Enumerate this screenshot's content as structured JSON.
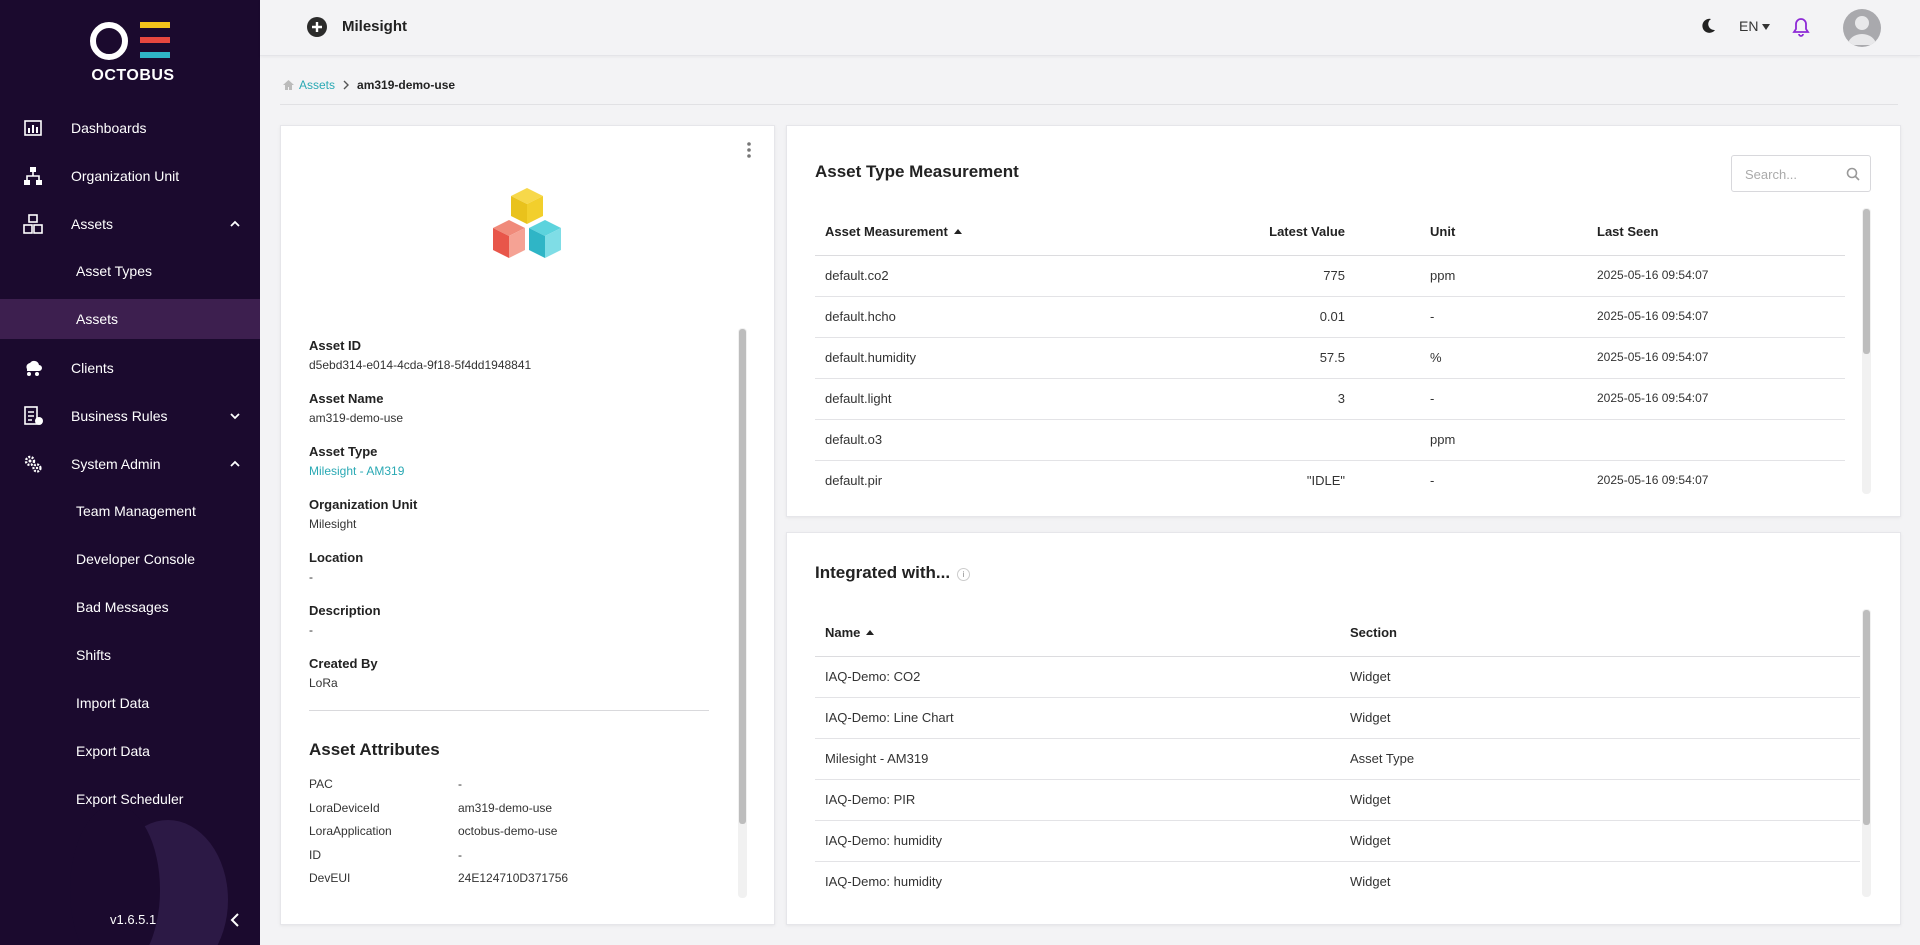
{
  "brand": {
    "name": "OCTOBUS",
    "colors": {
      "sidebar": "#1b0a2e",
      "accent": "#2aa9b4",
      "bell": "#8e2bd6"
    }
  },
  "sidebar": {
    "items": [
      {
        "label": "Dashboards",
        "icon": "dashboard-icon"
      },
      {
        "label": "Organization Unit",
        "icon": "org-chart-icon"
      },
      {
        "label": "Assets",
        "icon": "cubes-icon",
        "expanded": true
      },
      {
        "label": "Clients",
        "icon": "cloud-users-icon"
      },
      {
        "label": "Business Rules",
        "icon": "rules-icon",
        "expanded": false
      },
      {
        "label": "System Admin",
        "icon": "gears-icon",
        "expanded": true
      }
    ],
    "asset_subitems": [
      "Asset Types",
      "Assets"
    ],
    "admin_subitems": [
      "Team Management",
      "Developer Console",
      "Bad Messages",
      "Shifts",
      "Import Data",
      "Export Data",
      "Export Scheduler"
    ],
    "active": "Assets",
    "version": "v1.6.5.1"
  },
  "topbar": {
    "org_name": "Milesight",
    "language": "EN"
  },
  "breadcrumb": {
    "parent": "Assets",
    "current": "am319-demo-use"
  },
  "asset": {
    "fields": [
      {
        "label": "Asset ID",
        "value": "d5ebd314-e014-4cda-9f18-5f4dd1948841"
      },
      {
        "label": "Asset Name",
        "value": "am319-demo-use"
      },
      {
        "label": "Asset Type",
        "value": "Milesight - AM319",
        "link": true
      },
      {
        "label": "Organization Unit",
        "value": "Milesight"
      },
      {
        "label": "Location",
        "value": "-"
      },
      {
        "label": "Description",
        "value": "-"
      },
      {
        "label": "Created By",
        "value": "LoRa"
      }
    ],
    "attributes_title": "Asset Attributes",
    "attributes": [
      {
        "key": "PAC",
        "value": "-"
      },
      {
        "key": "LoraDeviceId",
        "value": "am319-demo-use"
      },
      {
        "key": "LoraApplication",
        "value": "octobus-demo-use"
      },
      {
        "key": "ID",
        "value": "-"
      },
      {
        "key": "DevEUI",
        "value": "24E124710D371756"
      }
    ]
  },
  "measurements": {
    "title": "Asset Type Measurement",
    "search_placeholder": "Search...",
    "columns": [
      "Asset Measurement",
      "Latest Value",
      "Unit",
      "Last Seen"
    ],
    "rows": [
      {
        "name": "default.co2",
        "value": "775",
        "unit": "ppm",
        "last_seen": "2025-05-16 09:54:07"
      },
      {
        "name": "default.hcho",
        "value": "0.01",
        "unit": "-",
        "last_seen": "2025-05-16 09:54:07"
      },
      {
        "name": "default.humidity",
        "value": "57.5",
        "unit": "%",
        "last_seen": "2025-05-16 09:54:07"
      },
      {
        "name": "default.light",
        "value": "3",
        "unit": "-",
        "last_seen": "2025-05-16 09:54:07"
      },
      {
        "name": "default.o3",
        "value": "",
        "unit": "ppm",
        "last_seen": ""
      },
      {
        "name": "default.pir",
        "value": "\"IDLE\"",
        "unit": "-",
        "last_seen": "2025-05-16 09:54:07"
      }
    ]
  },
  "integrations": {
    "title": "Integrated with...",
    "info_glyph": "i",
    "columns": [
      "Name",
      "Section"
    ],
    "rows": [
      {
        "name": "IAQ-Demo: CO2",
        "section": "Widget"
      },
      {
        "name": "IAQ-Demo: Line Chart",
        "section": "Widget"
      },
      {
        "name": "Milesight - AM319",
        "section": "Asset Type"
      },
      {
        "name": "IAQ-Demo: PIR",
        "section": "Widget"
      },
      {
        "name": "IAQ-Demo: humidity",
        "section": "Widget"
      },
      {
        "name": "IAQ-Demo: humidity",
        "section": "Widget"
      }
    ]
  }
}
